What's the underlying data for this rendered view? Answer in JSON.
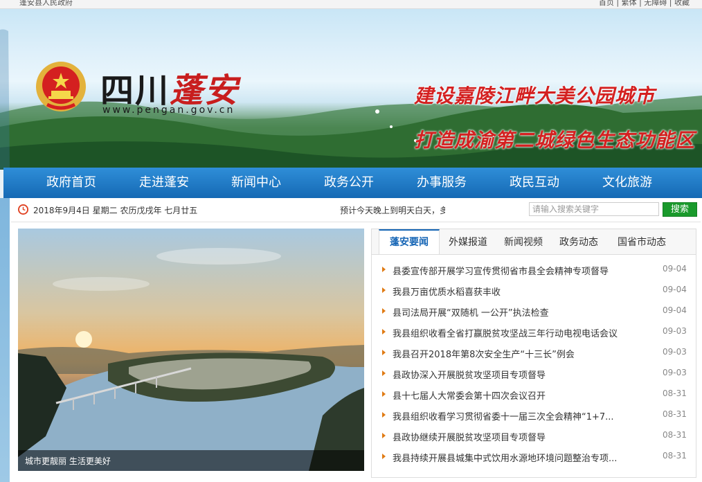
{
  "topbar": {
    "left_text": "蓬安县人民政府",
    "right_text": "首页 | 繁体 | 无障碍 | 收藏"
  },
  "logo": {
    "name_black": "四川",
    "name_red": "蓬安",
    "url": "www.pengan.gov.cn"
  },
  "slogans": [
    "建设嘉陵江畔大美公园城市",
    "打造成渝第二城绿色生态功能区"
  ],
  "nav": [
    {
      "label": "政府首页"
    },
    {
      "label": "走进蓬安"
    },
    {
      "label": "新闻中心"
    },
    {
      "label": "政务公开"
    },
    {
      "label": "办事服务"
    },
    {
      "label": "政民互动"
    },
    {
      "label": "文化旅游"
    }
  ],
  "infobar": {
    "date": "2018年9月4日 星期二 农历戊戌年 七月廿五",
    "weather": "预计今天晚上到明天白天，多云",
    "search_placeholder": "请输入搜索关键字",
    "search_button": "搜索"
  },
  "photo": {
    "caption": "城市更靓丽 生活更美好"
  },
  "tabs": [
    {
      "label": "蓬安要闻"
    },
    {
      "label": "外媒报道"
    },
    {
      "label": "新闻视频"
    },
    {
      "label": "政务动态"
    },
    {
      "label": "国省市动态"
    }
  ],
  "news": [
    {
      "title": "县委宣传部开展学习宣传贯彻省市县全会精神专项督导",
      "date": "09-04"
    },
    {
      "title": "我县万亩优质水稻喜获丰收",
      "date": "09-04"
    },
    {
      "title": "县司法局开展“双随机 一公开”执法检查",
      "date": "09-04"
    },
    {
      "title": "我县组织收看全省打赢脱贫攻坚战三年行动电视电话会议",
      "date": "09-03"
    },
    {
      "title": "我县召开2018年第8次安全生产“十三长”例会",
      "date": "09-03"
    },
    {
      "title": "县政协深入开展脱贫攻坚项目专项督导",
      "date": "09-03"
    },
    {
      "title": "县十七届人大常委会第十四次会议召开",
      "date": "08-31"
    },
    {
      "title": "我县组织收看学习贯彻省委十一届三次全会精神“1+7...",
      "date": "08-31"
    },
    {
      "title": "县政协继续开展脱贫攻坚项目专项督导",
      "date": "08-31"
    },
    {
      "title": "我县持续开展县城集中式饮用水源地环境问题整治专项...",
      "date": "08-31"
    }
  ]
}
